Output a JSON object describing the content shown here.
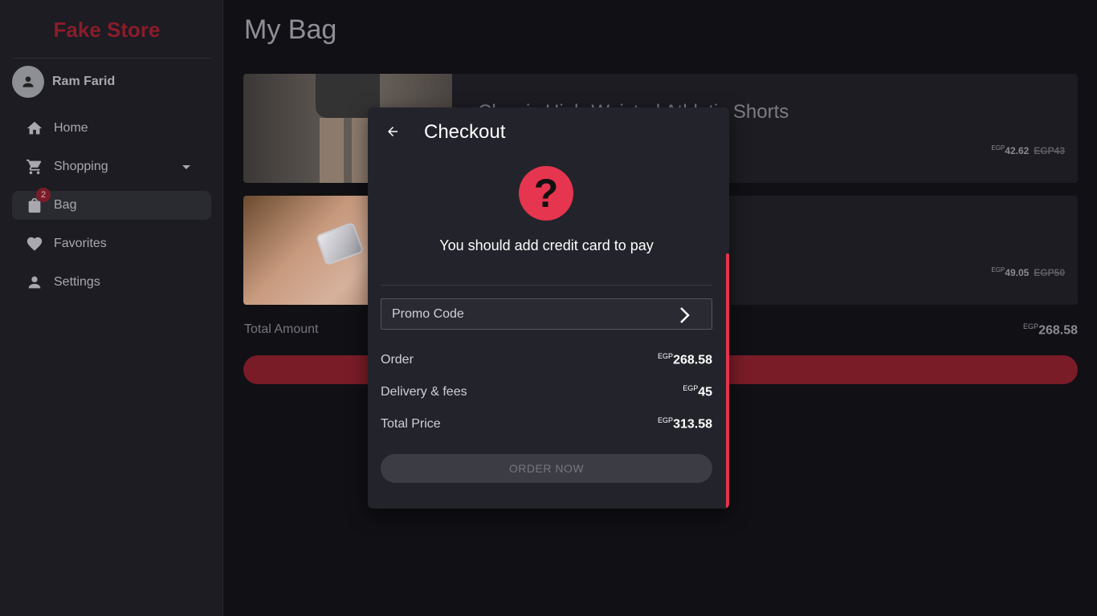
{
  "sidebar": {
    "brand": "Fake Store",
    "user": {
      "name": "Ram Farid"
    },
    "items": [
      {
        "label": "Home",
        "icon": "home-icon"
      },
      {
        "label": "Shopping",
        "icon": "cart-icon"
      },
      {
        "label": "Bag",
        "icon": "bag-icon",
        "badge": "2"
      },
      {
        "label": "Favorites",
        "icon": "heart-icon"
      },
      {
        "label": "Settings",
        "icon": "person-icon"
      }
    ]
  },
  "main": {
    "title": "My Bag",
    "items": [
      {
        "name": "Classic High-Waisted Athletic Shorts",
        "currency": "EGP",
        "price": "42.62",
        "old_price": "EGP43"
      },
      {
        "name": "",
        "currency": "EGP",
        "price": "49.05",
        "old_price": "EGP50"
      }
    ],
    "total_label": "Total Amount",
    "total_currency": "EGP",
    "total_value": "268.58"
  },
  "checkout": {
    "title": "Checkout",
    "message": "You should add credit card to pay",
    "promo_label": "Promo Code",
    "rows": [
      {
        "label": "Order",
        "currency": "EGP",
        "value": "268.58"
      },
      {
        "label": "Delivery & fees",
        "currency": "EGP",
        "value": "45"
      },
      {
        "label": "Total Price",
        "currency": "EGP",
        "value": "313.58"
      }
    ],
    "order_button": "ORDER NOW"
  },
  "colors": {
    "accent": "#e5354f",
    "brand": "#8a1c2a",
    "dialog_bg": "#23232b",
    "sidebar_bg": "#1c1c22"
  }
}
